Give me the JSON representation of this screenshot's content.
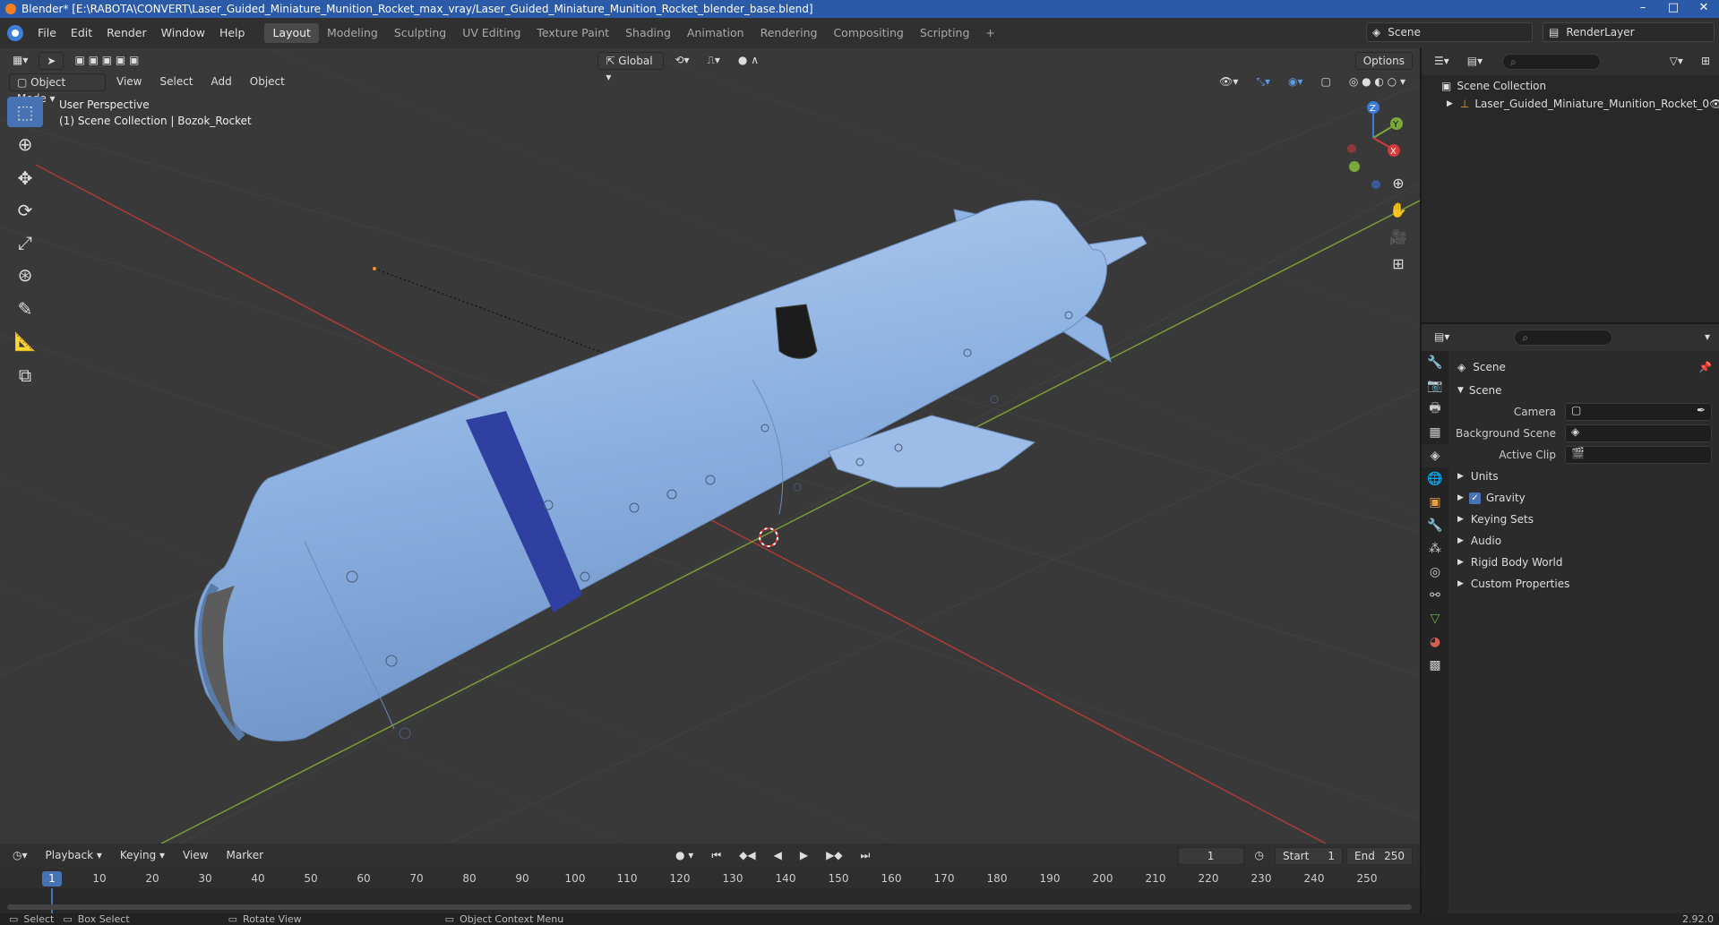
{
  "titlebar": {
    "title": "Blender* [E:\\RABOTA\\CONVERT\\Laser_Guided_Miniature_Munition_Rocket_max_vray/Laser_Guided_Miniature_Munition_Rocket_blender_base.blend]",
    "minimize": "–",
    "maximize": "□",
    "close": "✕"
  },
  "menubar": {
    "menus": [
      "File",
      "Edit",
      "Render",
      "Window",
      "Help"
    ],
    "workspaces": [
      "Layout",
      "Modeling",
      "Sculpting",
      "UV Editing",
      "Texture Paint",
      "Shading",
      "Animation",
      "Rendering",
      "Compositing",
      "Scripting"
    ],
    "add_workspace": "+",
    "scene": "Scene",
    "render_layer": "RenderLayer"
  },
  "viewport": {
    "mode": "Object Mode",
    "menus": [
      "View",
      "Select",
      "Add",
      "Object"
    ],
    "transform_orientation": "Global",
    "options": "Options",
    "info_line1": "User Perspective",
    "info_line2": "(1) Scene Collection | Bozok_Rocket",
    "axes": {
      "x": "X",
      "y": "Y",
      "z": "Z"
    }
  },
  "timeline": {
    "menus": [
      "Playback",
      "Keying",
      "View",
      "Marker"
    ],
    "current_frame": "1",
    "start_label": "Start",
    "start": "1",
    "end_label": "End",
    "end": "250",
    "ticks": [
      "10",
      "20",
      "30",
      "40",
      "50",
      "60",
      "70",
      "80",
      "90",
      "100",
      "110",
      "120",
      "130",
      "140",
      "150",
      "160",
      "170",
      "180",
      "190",
      "200",
      "210",
      "220",
      "230",
      "240",
      "250"
    ]
  },
  "statusbar": {
    "select": "Select",
    "box_select": "Box Select",
    "rotate_view": "Rotate View",
    "context_menu": "Object Context Menu",
    "version": "2.92.0"
  },
  "outliner": {
    "root": "Scene Collection",
    "items": [
      "Laser_Guided_Miniature_Munition_Rocket_0"
    ]
  },
  "properties": {
    "context": "Scene",
    "panel": "Scene",
    "fields": [
      {
        "label": "Camera",
        "value": ""
      },
      {
        "label": "Background Scene",
        "value": ""
      },
      {
        "label": "Active Clip",
        "value": ""
      }
    ],
    "sections": [
      "Units",
      "Gravity",
      "Keying Sets",
      "Audio",
      "Rigid Body World",
      "Custom Properties"
    ]
  },
  "colors": {
    "accent": "#4772b3",
    "viewport_bg": "#393939",
    "x_axis": "#c04444",
    "y_axis": "#7aa03a",
    "rocket": "#8ab0e0",
    "band": "#3040a0"
  }
}
